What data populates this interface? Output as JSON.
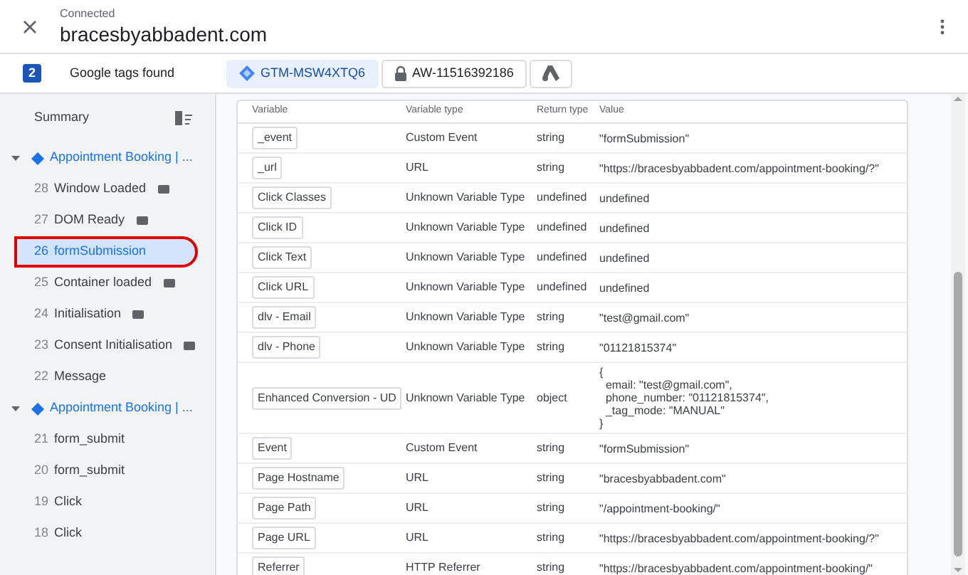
{
  "header": {
    "status": "Connected",
    "domain": "bracesbyabbadent.com"
  },
  "tag_bar": {
    "count": "2",
    "label": "Google tags found",
    "tags": [
      {
        "kind": "gtm",
        "label": "GTM-MSW4XTQ6",
        "selected": true
      },
      {
        "kind": "aw",
        "label": "AW-11516392186",
        "selected": false
      },
      {
        "kind": "ads",
        "selected": false
      }
    ]
  },
  "sidebar": {
    "summary": "Summary",
    "groups": [
      {
        "title": "Appointment Booking | ...",
        "expanded": true,
        "items": [
          {
            "number": "28",
            "label": "Window Loaded",
            "badge": true,
            "selected": false
          },
          {
            "number": "27",
            "label": "DOM Ready",
            "badge": true,
            "selected": false
          },
          {
            "number": "26",
            "label": "formSubmission",
            "badge": false,
            "selected": true
          },
          {
            "number": "25",
            "label": "Container loaded",
            "badge": true,
            "selected": false
          },
          {
            "number": "24",
            "label": "Initialisation",
            "badge": true,
            "selected": false
          },
          {
            "number": "23",
            "label": "Consent Initialisation",
            "badge": true,
            "selected": false
          },
          {
            "number": "22",
            "label": "Message",
            "badge": false,
            "selected": false
          }
        ]
      },
      {
        "title": "Appointment Booking | ...",
        "expanded": true,
        "items": [
          {
            "number": "21",
            "label": "form_submit",
            "badge": false,
            "selected": false
          },
          {
            "number": "20",
            "label": "form_submit",
            "badge": false,
            "selected": false
          },
          {
            "number": "19",
            "label": "Click",
            "badge": false,
            "selected": false
          },
          {
            "number": "18",
            "label": "Click",
            "badge": false,
            "selected": false
          }
        ]
      }
    ]
  },
  "table": {
    "columns": [
      "Variable",
      "Variable type",
      "Return type",
      "Value"
    ],
    "rows": [
      {
        "variable": "_event",
        "type": "Custom Event",
        "return": "string",
        "value": [
          "\"formSubmission\""
        ]
      },
      {
        "variable": "_url",
        "type": "URL",
        "return": "string",
        "value": [
          "\"https://bracesbyabbadent.com/appointment-booking/?\""
        ]
      },
      {
        "variable": "Click Classes",
        "type": "Unknown Variable Type",
        "return": "undefined",
        "value": [
          "undefined"
        ]
      },
      {
        "variable": "Click ID",
        "type": "Unknown Variable Type",
        "return": "undefined",
        "value": [
          "undefined"
        ]
      },
      {
        "variable": "Click Text",
        "type": "Unknown Variable Type",
        "return": "undefined",
        "value": [
          "undefined"
        ]
      },
      {
        "variable": "Click URL",
        "type": "Unknown Variable Type",
        "return": "undefined",
        "value": [
          "undefined"
        ]
      },
      {
        "variable": "dlv - Email",
        "type": "Unknown Variable Type",
        "return": "string",
        "value": [
          "\"test@gmail.com\""
        ]
      },
      {
        "variable": "dlv - Phone",
        "type": "Unknown Variable Type",
        "return": "string",
        "value": [
          "\"01121815374\""
        ]
      },
      {
        "variable": "Enhanced Conversion - UD",
        "type": "Unknown Variable Type",
        "return": "object",
        "value": [
          "{",
          "  email: \"test@gmail.com\",",
          "  phone_number: \"01121815374\",",
          "  _tag_mode: \"MANUAL\"",
          "}"
        ]
      },
      {
        "variable": "Event",
        "type": "Custom Event",
        "return": "string",
        "value": [
          "\"formSubmission\""
        ]
      },
      {
        "variable": "Page Hostname",
        "type": "URL",
        "return": "string",
        "value": [
          "\"bracesbyabbadent.com\""
        ]
      },
      {
        "variable": "Page Path",
        "type": "URL",
        "return": "string",
        "value": [
          "\"/appointment-booking/\""
        ]
      },
      {
        "variable": "Page URL",
        "type": "URL",
        "return": "string",
        "value": [
          "\"https://bracesbyabbadent.com/appointment-booking/?\""
        ]
      },
      {
        "variable": "Referrer",
        "type": "HTTP Referrer",
        "return": "string",
        "value": [
          "\"https://bracesbyabbadent.com/appointment-booking/\""
        ]
      }
    ]
  }
}
